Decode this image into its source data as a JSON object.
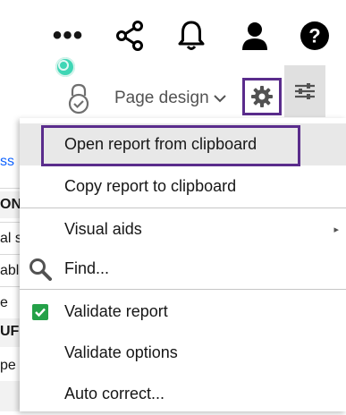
{
  "topbar": {
    "more_label": "•••",
    "icons": [
      "more-icon",
      "share-icon",
      "notification-icon",
      "user-icon",
      "help-icon"
    ],
    "status_color": "#3fd6b5"
  },
  "toolbar": {
    "page_design_label": "Page design",
    "page_design_caret": "∨",
    "highlight_color": "#5a2c8c"
  },
  "background_page": {
    "fragments": [
      "ss",
      "ON",
      "al s",
      "abl",
      "e",
      "UF",
      "pe"
    ]
  },
  "menu": {
    "items": [
      {
        "label": "Open report from clipboard",
        "highlighted": true
      },
      {
        "label": "Copy report to clipboard"
      },
      {
        "label": "Visual aids",
        "submenu": true,
        "caret": "▸"
      },
      {
        "label": "Find...",
        "icon": "search-icon"
      },
      {
        "label": "Validate report",
        "icon": "checkbox-checked-icon",
        "checked": true
      },
      {
        "label": "Validate options"
      },
      {
        "label": "Auto correct..."
      }
    ]
  }
}
